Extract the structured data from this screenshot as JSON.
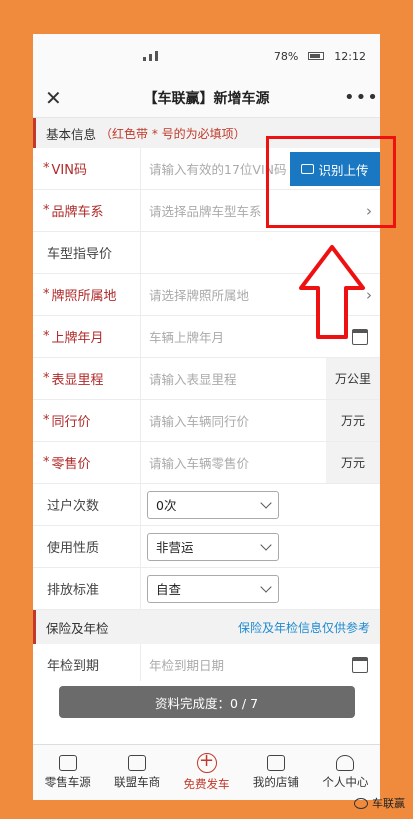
{
  "status_bar": {
    "battery": "78%",
    "time": "12:12"
  },
  "header": {
    "title": "【车联赢】新增车源",
    "close": "✕",
    "more": "•••"
  },
  "section_basic": {
    "title": "基本信息",
    "note": "（红色带 * 号的为必填项）"
  },
  "fields": {
    "vin": {
      "label": "VIN码",
      "placeholder": "请输入有效的17位VIN码",
      "button": "识别上传"
    },
    "brand": {
      "label": "品牌车系",
      "placeholder": "请选择品牌车型车系"
    },
    "guide_price": {
      "label": "车型指导价"
    },
    "plate_location": {
      "label": "牌照所属地",
      "placeholder": "请选择牌照所属地"
    },
    "plate_date": {
      "label": "上牌年月",
      "placeholder": "车辆上牌年月"
    },
    "mileage": {
      "label": "表显里程",
      "placeholder": "请输入表显里程",
      "unit": "万公里"
    },
    "peer_price": {
      "label": "同行价",
      "placeholder": "请输入车辆同行价",
      "unit": "万元"
    },
    "retail_price": {
      "label": "零售价",
      "placeholder": "请输入车辆零售价",
      "unit": "万元"
    },
    "transfers": {
      "label": "过户次数",
      "value": "0次"
    },
    "usage": {
      "label": "使用性质",
      "value": "非营运"
    },
    "emission": {
      "label": "排放标准",
      "value": "自查"
    }
  },
  "section_insurance": {
    "title": "保险及年检",
    "link": "保险及年检信息仅供参考"
  },
  "inspection": {
    "label": "年检到期",
    "placeholder": "年检到期日期"
  },
  "progress": {
    "text": "资料完成度：0 / 7"
  },
  "tabs": [
    {
      "label": "零售车源"
    },
    {
      "label": "联盟车商"
    },
    {
      "label": "免费发车"
    },
    {
      "label": "我的店铺"
    },
    {
      "label": "个人中心"
    }
  ],
  "watermark": {
    "right": "车联赢"
  },
  "colors": {
    "background": "#f08a3c",
    "accent_red": "#c0392b",
    "button_blue": "#1a78c2",
    "annotation_red": "#e11111"
  }
}
